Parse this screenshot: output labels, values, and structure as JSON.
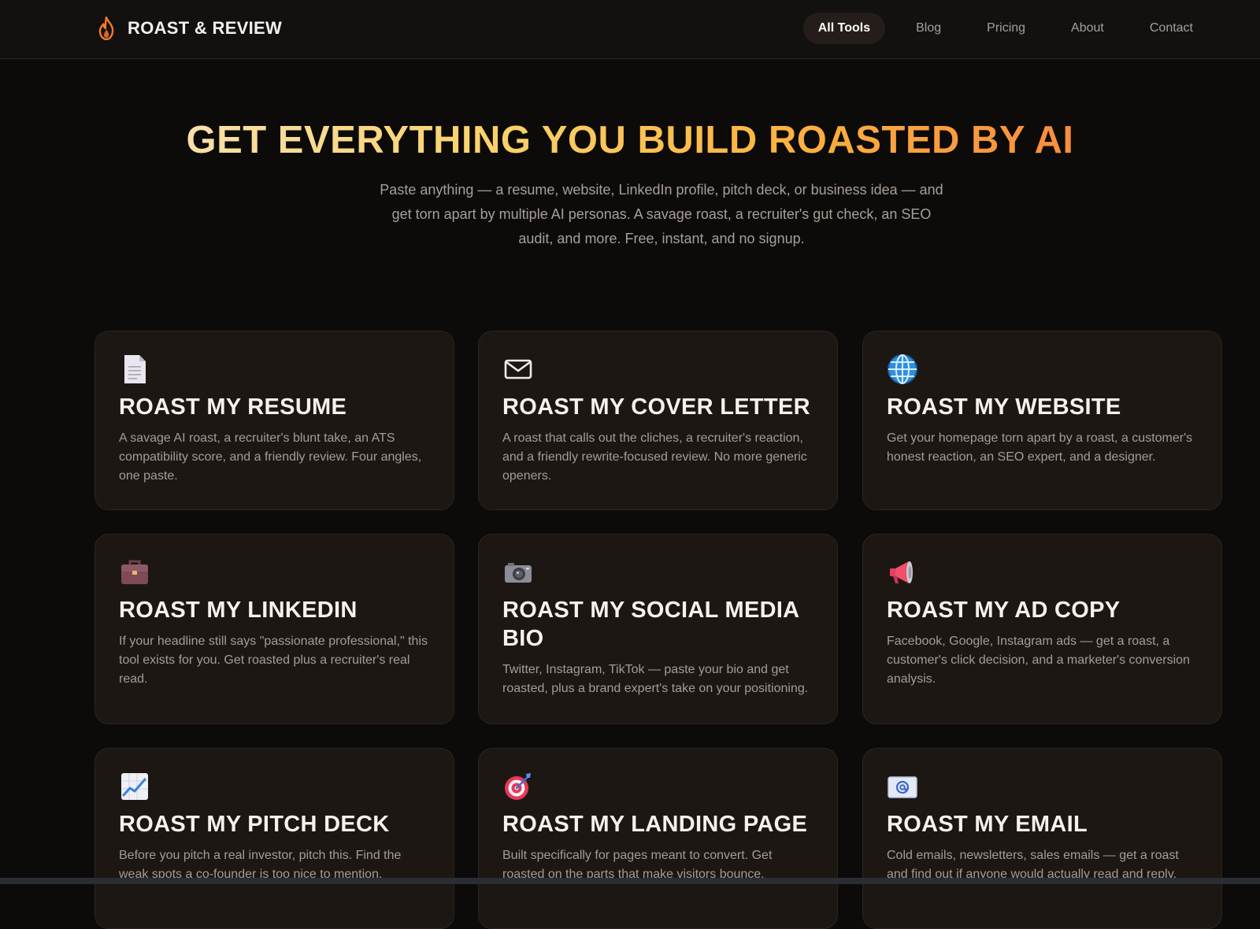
{
  "brand": {
    "name": "ROAST & REVIEW",
    "accent": "#f47a2a"
  },
  "nav": {
    "items": [
      {
        "label": "All Tools",
        "active": true
      },
      {
        "label": "Blog",
        "active": false
      },
      {
        "label": "Pricing",
        "active": false
      },
      {
        "label": "About",
        "active": false
      },
      {
        "label": "Contact",
        "active": false
      }
    ]
  },
  "hero": {
    "title": "GET EVERYTHING YOU BUILD ROASTED BY AI",
    "subtitle": "Paste anything — a resume, website, LinkedIn profile, pitch deck, or business idea — and get torn apart by multiple AI personas. A savage roast, a recruiter's gut check, an SEO audit, and more. Free, instant, and no signup."
  },
  "tools": [
    {
      "icon": "document-icon",
      "title": "ROAST MY RESUME",
      "description": "A savage AI roast, a recruiter's blunt take, an ATS compatibility score, and a friendly review. Four angles, one paste."
    },
    {
      "icon": "envelope-icon",
      "title": "ROAST MY COVER LETTER",
      "description": "A roast that calls out the cliches, a recruiter's reaction, and a friendly rewrite-focused review. No more generic openers."
    },
    {
      "icon": "globe-icon",
      "title": "ROAST MY WEBSITE",
      "description": "Get your homepage torn apart by a roast, a customer's honest reaction, an SEO expert, and a designer."
    },
    {
      "icon": "briefcase-icon",
      "title": "ROAST MY LINKEDIN",
      "description": "If your headline still says \"passionate professional,\" this tool exists for you. Get roasted plus a recruiter's real read."
    },
    {
      "icon": "camera-icon",
      "title": "ROAST MY SOCIAL MEDIA BIO",
      "description": "Twitter, Instagram, TikTok — paste your bio and get roasted, plus a brand expert's take on your positioning."
    },
    {
      "icon": "megaphone-icon",
      "title": "ROAST MY AD COPY",
      "description": "Facebook, Google, Instagram ads — get a roast, a customer's click decision, and a marketer's conversion analysis."
    },
    {
      "icon": "chart-up-icon",
      "title": "ROAST MY PITCH DECK",
      "description": "Before you pitch a real investor, pitch this. Find the weak spots a co-founder is too nice to mention."
    },
    {
      "icon": "target-icon",
      "title": "ROAST MY LANDING PAGE",
      "description": "Built specifically for pages meant to convert. Get roasted on the parts that make visitors bounce."
    },
    {
      "icon": "email-icon",
      "title": "ROAST MY EMAIL",
      "description": "Cold emails, newsletters, sales emails — get a roast and find out if anyone would actually read and reply."
    }
  ]
}
